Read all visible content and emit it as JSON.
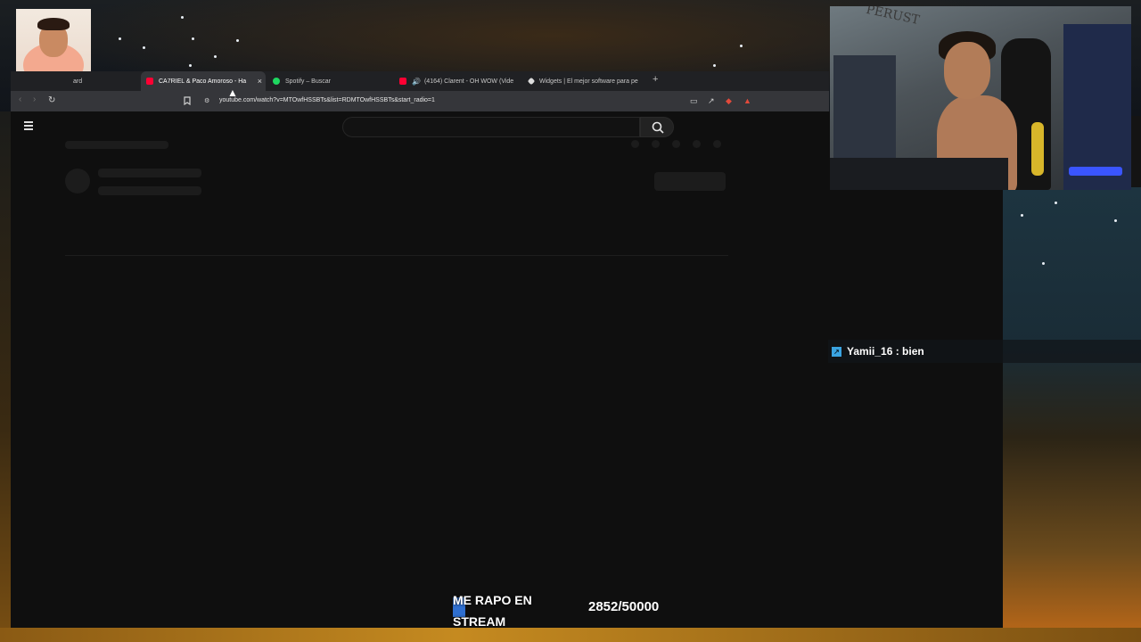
{
  "browser": {
    "tabs": [
      {
        "title": "ard",
        "favicon_color": "#35363a"
      },
      {
        "title": "CA7RIEL & Paco Amoroso - Ha",
        "favicon_color": "#ff0033",
        "active": true
      },
      {
        "title": "Spotify – Buscar",
        "favicon_color": "#1ed760"
      },
      {
        "title": "(4164) Clarent - OH WOW (Vide",
        "favicon_color": "#ff0033",
        "audio": true
      },
      {
        "title": "Widgets | El mejor software para pe",
        "favicon_color": "#dddddd"
      }
    ],
    "close_glyph": "×",
    "new_tab_glyph": "+",
    "url": "youtube.com/watch?v=MTOwfHSSBTs&list=RDMTOwfHSSBTs&start_radio=1",
    "icons": [
      "back-icon",
      "forward-icon",
      "reload-icon",
      "bookmark-icon",
      "site-info-icon",
      "cast-icon",
      "share-icon",
      "extension-shield-icon",
      "extension-warning-icon"
    ]
  },
  "youtube": {
    "icons": [
      "menu-icon",
      "search-icon"
    ],
    "loading": true
  },
  "chat": {
    "message": "Yamii_16 : bien",
    "badge_color": "#3aa3e0"
  },
  "goal": {
    "label": "ME RAPO EN STREAM",
    "count": "2852/50000",
    "current": 2852,
    "target": 50000,
    "fill_color": "#2f6fd0"
  }
}
